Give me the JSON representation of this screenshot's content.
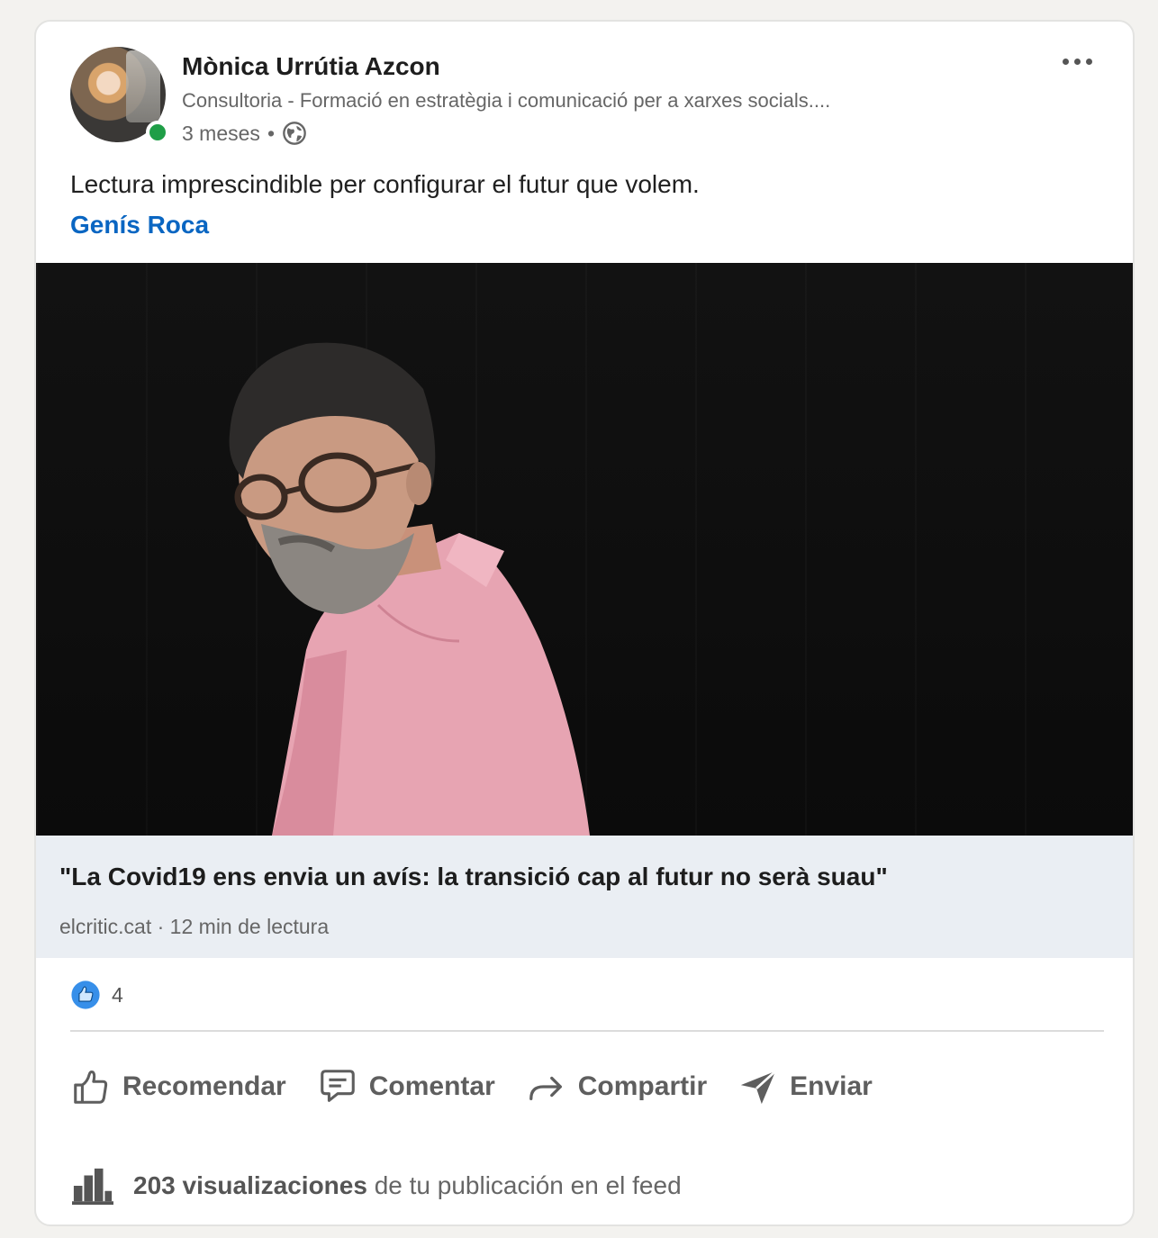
{
  "post": {
    "author": {
      "name": "Mònica Urrútia Azcon",
      "headline": "Consultoria - Formació en estratègia i comunicació per a xarxes socials....",
      "time": "3 meses",
      "separator": "•",
      "visibility_icon": "globe-icon",
      "online": true
    },
    "more_icon": "more-options-icon",
    "text": "Lectura imprescindible per configurar el futur que volem.",
    "mention": "Genís Roca",
    "article": {
      "title": "\"La Covid19 ens envia un avís: la transició cap al futur no serà suau\"",
      "source": "elcritic.cat · 12 min de lectura"
    },
    "reactions": {
      "icon": "like-reaction-icon",
      "count": "4"
    },
    "actions": [
      {
        "label": "Recomendar",
        "icon": "thumbs-up-icon"
      },
      {
        "label": "Comentar",
        "icon": "comment-icon"
      },
      {
        "label": "Compartir",
        "icon": "share-arrow-icon"
      },
      {
        "label": "Enviar",
        "icon": "send-icon"
      }
    ],
    "views": {
      "icon": "bar-chart-icon",
      "count_text": "203 visualizaciones",
      "rest_text": " de tu publicación en el feed"
    },
    "colors": {
      "link": "#0a66c2",
      "online": "#1f9e47",
      "caption_bg": "#eaeef3"
    }
  }
}
